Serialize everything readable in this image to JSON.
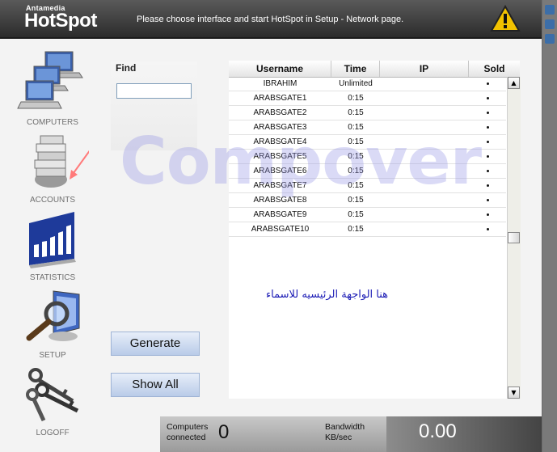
{
  "header": {
    "brand_small": "Antamedia",
    "brand_hot": "Hot",
    "brand_spot": "Spot",
    "message": "Please choose interface and start HotSpot in Setup - Network page."
  },
  "sidebar": {
    "items": [
      {
        "label": "COMPUTERS",
        "icon": "computers-icon"
      },
      {
        "label": "ACCOUNTS",
        "icon": "accounts-icon"
      },
      {
        "label": "STATISTICS",
        "icon": "statistics-icon"
      },
      {
        "label": "SETUP",
        "icon": "setup-icon"
      },
      {
        "label": "LOGOFF",
        "icon": "logoff-icon"
      }
    ]
  },
  "find": {
    "label": "Find",
    "value": ""
  },
  "buttons": {
    "generate": "Generate",
    "show_all": "Show All"
  },
  "table": {
    "headers": [
      "Username",
      "Time",
      "IP",
      "Sold"
    ],
    "rows": [
      {
        "username": "IBRAHIM",
        "time": "Unlimited",
        "ip": ""
      },
      {
        "username": "ARABSGATE1",
        "time": "0:15",
        "ip": ""
      },
      {
        "username": "ARABSGATE2",
        "time": "0:15",
        "ip": ""
      },
      {
        "username": "ARABSGATE3",
        "time": "0:15",
        "ip": ""
      },
      {
        "username": "ARABSGATE4",
        "time": "0:15",
        "ip": ""
      },
      {
        "username": "ARABSGATE5",
        "time": "0:15",
        "ip": ""
      },
      {
        "username": "ARABSGATE6",
        "time": "0:15",
        "ip": ""
      },
      {
        "username": "ARABSGATE7",
        "time": "0:15",
        "ip": ""
      },
      {
        "username": "ARABSGATE8",
        "time": "0:15",
        "ip": ""
      },
      {
        "username": "ARABSGATE9",
        "time": "0:15",
        "ip": ""
      },
      {
        "username": "ARABSGATE10",
        "time": "0:15",
        "ip": ""
      }
    ]
  },
  "annotation": "هنا الواجهة الرئيسيه للاسماء",
  "watermark": "Compover",
  "footer": {
    "computers_label_1": "Computers",
    "computers_label_2": "connected",
    "computers_value": "0",
    "bandwidth_label_1": "Bandwidth",
    "bandwidth_label_2": "KB/sec",
    "bandwidth_value": "0.00"
  },
  "colors": {
    "accent": "#1b1bb5",
    "header": "#2b2b2b",
    "warning": "#f2c200"
  }
}
